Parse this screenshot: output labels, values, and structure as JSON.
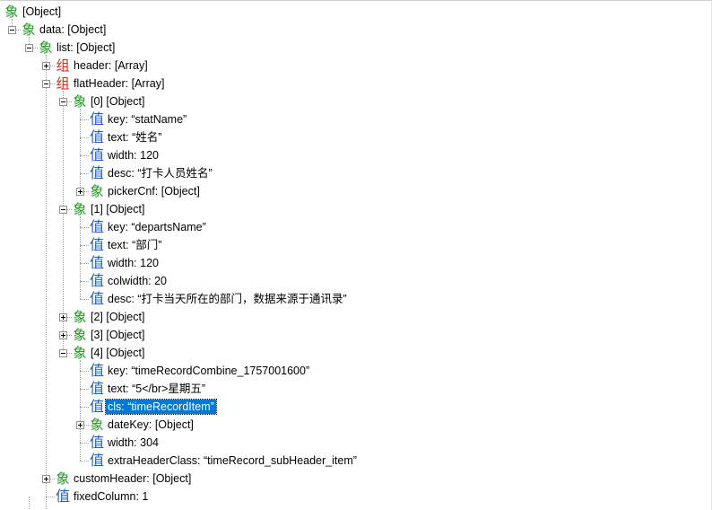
{
  "icons": {
    "obj": "象",
    "arr": "组",
    "val": "值"
  },
  "nodes": [
    {
      "depth": 0,
      "type": "obj",
      "text": "[Object]",
      "expander": "none"
    },
    {
      "depth": 1,
      "type": "obj",
      "text": "data: [Object]",
      "expander": "minus"
    },
    {
      "depth": 2,
      "type": "obj",
      "text": "list: [Object]",
      "expander": "minus"
    },
    {
      "depth": 3,
      "type": "arr",
      "text": "header: [Array]",
      "expander": "plus"
    },
    {
      "depth": 3,
      "type": "arr",
      "text": "flatHeader: [Array]",
      "expander": "minus"
    },
    {
      "depth": 4,
      "type": "obj",
      "text": "[0] [Object]",
      "expander": "minus"
    },
    {
      "depth": 5,
      "type": "val",
      "text": "key: “statName”",
      "expander": "none"
    },
    {
      "depth": 5,
      "type": "val",
      "text": "text: “姓名”",
      "expander": "none"
    },
    {
      "depth": 5,
      "type": "val",
      "text": "width: 120",
      "expander": "none"
    },
    {
      "depth": 5,
      "type": "val",
      "text": "desc: “打卡人员姓名”",
      "expander": "none"
    },
    {
      "depth": 5,
      "type": "obj",
      "text": "pickerCnf: [Object]",
      "expander": "plus"
    },
    {
      "depth": 4,
      "type": "obj",
      "text": "[1] [Object]",
      "expander": "minus"
    },
    {
      "depth": 5,
      "type": "val",
      "text": "key: “departsName”",
      "expander": "none"
    },
    {
      "depth": 5,
      "type": "val",
      "text": "text: “部门”",
      "expander": "none"
    },
    {
      "depth": 5,
      "type": "val",
      "text": "width: 120",
      "expander": "none"
    },
    {
      "depth": 5,
      "type": "val",
      "text": "colwidth: 20",
      "expander": "none"
    },
    {
      "depth": 5,
      "type": "val",
      "text": "desc: “打卡当天所在的部门，数据来源于通讯录”",
      "expander": "none"
    },
    {
      "depth": 4,
      "type": "obj",
      "text": "[2] [Object]",
      "expander": "plus"
    },
    {
      "depth": 4,
      "type": "obj",
      "text": "[3] [Object]",
      "expander": "plus"
    },
    {
      "depth": 4,
      "type": "obj",
      "text": "[4] [Object]",
      "expander": "minus"
    },
    {
      "depth": 5,
      "type": "val",
      "text": "key: “timeRecordCombine_1757001600”",
      "expander": "none"
    },
    {
      "depth": 5,
      "type": "val",
      "text": "text: “5</br>星期五”",
      "expander": "none"
    },
    {
      "depth": 5,
      "type": "val",
      "text": "cls: “timeRecordItem”",
      "expander": "none",
      "selected": true
    },
    {
      "depth": 5,
      "type": "obj",
      "text": "dateKey: [Object]",
      "expander": "plus"
    },
    {
      "depth": 5,
      "type": "val",
      "text": "width: 304",
      "expander": "none"
    },
    {
      "depth": 5,
      "type": "val",
      "text": "extraHeaderClass: “timeRecord_subHeader_item”",
      "expander": "none"
    },
    {
      "depth": 3,
      "type": "obj",
      "text": "customHeader: [Object]",
      "expander": "plus"
    },
    {
      "depth": 3,
      "type": "val",
      "text": "fixedColumn: 1",
      "expander": "none"
    }
  ]
}
